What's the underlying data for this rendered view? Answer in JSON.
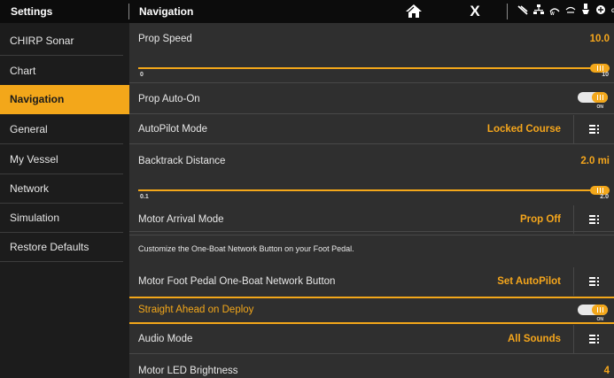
{
  "header": {
    "settings_title": "Settings",
    "nav_title": "Navigation",
    "close_label": "X",
    "status_icons": [
      "signal-icon",
      "network-icon",
      "wifi-icon",
      "vessel-icon",
      "autopilot-icon",
      "gps-icon"
    ]
  },
  "sidebar": {
    "items": [
      {
        "label": "CHIRP Sonar"
      },
      {
        "label": "Chart"
      },
      {
        "label": "Navigation"
      },
      {
        "label": "General"
      },
      {
        "label": "My Vessel"
      },
      {
        "label": "Network"
      },
      {
        "label": "Simulation"
      },
      {
        "label": "Restore Defaults"
      }
    ],
    "active_index": 2
  },
  "settings": {
    "prop_speed": {
      "label": "Prop Speed",
      "value": "10.0",
      "min": "0",
      "max": "10",
      "level": 1.0
    },
    "prop_auto_on": {
      "label": "Prop Auto-On",
      "state": "ON"
    },
    "autopilot_mode": {
      "label": "AutoPilot Mode",
      "value": "Locked Course"
    },
    "backtrack_distance": {
      "label": "Backtrack Distance",
      "value": "2.0 mi",
      "min": "0.1",
      "max": "2.0",
      "level": 1.0
    },
    "motor_arrival_mode": {
      "label": "Motor Arrival Mode",
      "value": "Prop Off"
    },
    "info_text": "Customize the One-Boat Network Button on your Foot Pedal.",
    "foot_pedal_button": {
      "label": "Motor Foot Pedal One-Boat Network Button",
      "value": "Set AutoPilot"
    },
    "straight_ahead": {
      "label": "Straight Ahead on Deploy",
      "state": "ON"
    },
    "audio_mode": {
      "label": "Audio Mode",
      "value": "All Sounds"
    },
    "motor_led_brightness": {
      "label": "Motor LED Brightness",
      "value": "4"
    }
  },
  "colors": {
    "accent": "#f3a71a",
    "background": "#2f2f2f",
    "sidebar": "#1c1c1c",
    "topbar": "#0c0c0c"
  }
}
